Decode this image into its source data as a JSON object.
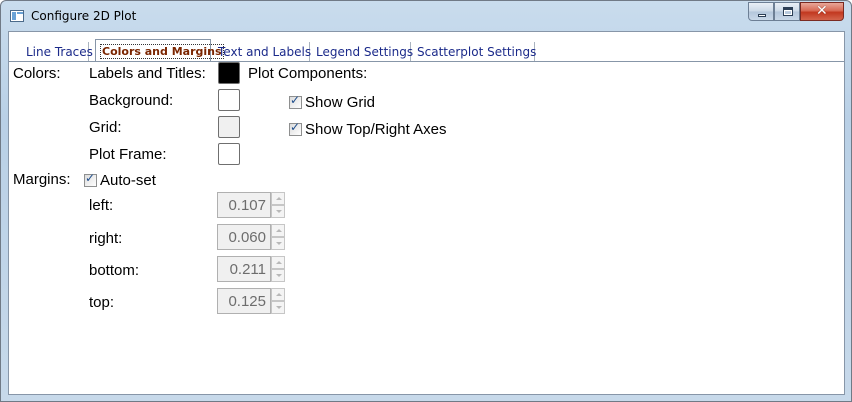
{
  "window": {
    "title": "Configure 2D Plot"
  },
  "tabs": [
    {
      "label": "Line Traces",
      "active": false
    },
    {
      "label": "Colors and Margins",
      "active": true
    },
    {
      "label": "Text and Labels",
      "active": false
    },
    {
      "label": "Legend Settings",
      "active": false
    },
    {
      "label": "Scatterplot Settings",
      "active": false
    }
  ],
  "colors": {
    "section_label": "Colors:",
    "labels_titles": {
      "label": "Labels and Titles:",
      "color": "#000000"
    },
    "background": {
      "label": "Background:",
      "color": "#ffffff"
    },
    "grid": {
      "label": "Grid:",
      "color": "#f0f0f0"
    },
    "plot_frame": {
      "label": "Plot Frame:",
      "color": "#ffffff"
    }
  },
  "plot_components": {
    "label": "Plot Components:",
    "show_grid": {
      "label": "Show Grid",
      "checked": true
    },
    "show_top_right_axes": {
      "label": "Show Top/Right Axes",
      "checked": true
    }
  },
  "margins": {
    "section_label": "Margins:",
    "auto_set": {
      "label": "Auto-set",
      "checked": true
    },
    "left": {
      "label": "left:",
      "value": "0.107"
    },
    "right": {
      "label": "right:",
      "value": "0.060"
    },
    "bottom": {
      "label": "bottom:",
      "value": "0.211"
    },
    "top": {
      "label": "top:",
      "value": "0.125"
    }
  }
}
